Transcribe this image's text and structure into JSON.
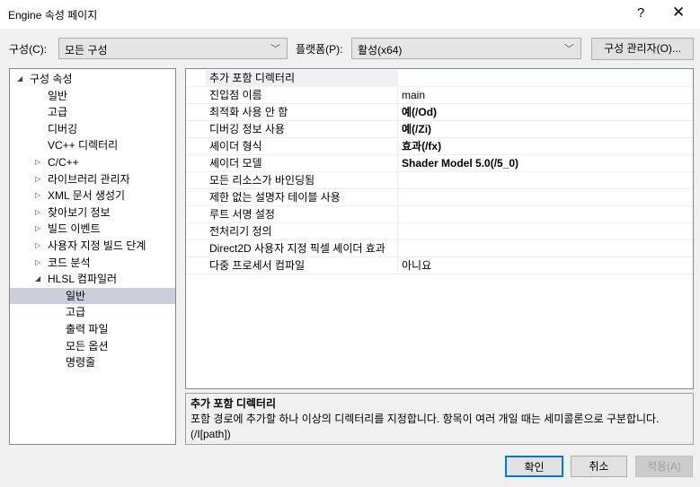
{
  "window": {
    "title": "Engine 속성 페이지",
    "help": "?",
    "close": "✕"
  },
  "toolbar": {
    "config_label": "구성(C):",
    "config_value": "모든 구성",
    "platform_label": "플랫폼(P):",
    "platform_value": "활성(x64)",
    "config_manager": "구성 관리자(O)..."
  },
  "tree": [
    {
      "label": "구성 속성",
      "level": 0,
      "arrow": "◢"
    },
    {
      "label": "일반",
      "level": 1,
      "arrow": ""
    },
    {
      "label": "고급",
      "level": 1,
      "arrow": ""
    },
    {
      "label": "디버깅",
      "level": 1,
      "arrow": ""
    },
    {
      "label": "VC++ 디렉터리",
      "level": 1,
      "arrow": ""
    },
    {
      "label": "C/C++",
      "level": 1,
      "arrow": "▷"
    },
    {
      "label": "라이브러리 관리자",
      "level": 1,
      "arrow": "▷"
    },
    {
      "label": "XML 문서 생성기",
      "level": 1,
      "arrow": "▷"
    },
    {
      "label": "찾아보기 정보",
      "level": 1,
      "arrow": "▷"
    },
    {
      "label": "빌드 이벤트",
      "level": 1,
      "arrow": "▷"
    },
    {
      "label": "사용자 지정 빌드 단계",
      "level": 1,
      "arrow": "▷"
    },
    {
      "label": "코드 분석",
      "level": 1,
      "arrow": "▷"
    },
    {
      "label": "HLSL 컴파일러",
      "level": 1,
      "arrow": "◢"
    },
    {
      "label": "일반",
      "level": 2,
      "arrow": "",
      "selected": true
    },
    {
      "label": "고급",
      "level": 2,
      "arrow": ""
    },
    {
      "label": "출력 파일",
      "level": 2,
      "arrow": ""
    },
    {
      "label": "모든 옵션",
      "level": 2,
      "arrow": ""
    },
    {
      "label": "명령줄",
      "level": 2,
      "arrow": ""
    }
  ],
  "properties": [
    {
      "name": "추가 포함 디렉터리",
      "value": "",
      "selected": true
    },
    {
      "name": "진입점 이름",
      "value": "main"
    },
    {
      "name": "최적화 사용 안 함",
      "value": "예(/Od)",
      "bold": true
    },
    {
      "name": "디버깅 정보 사용",
      "value": "예(/Zi)",
      "bold": true
    },
    {
      "name": "셰이더 형식",
      "value": "효과(/fx)",
      "bold": true
    },
    {
      "name": "셰이더 모델",
      "value": "Shader Model 5.0(/5_0)",
      "bold": true
    },
    {
      "name": "모든 리소스가 바인딩됨",
      "value": ""
    },
    {
      "name": "제한 없는 설명자 테이블 사용",
      "value": ""
    },
    {
      "name": "루트 서명 설정",
      "value": ""
    },
    {
      "name": "전처리기 정의",
      "value": ""
    },
    {
      "name": "Direct2D 사용자 지정 픽셀 셰이더 효과",
      "value": ""
    },
    {
      "name": "다중 프로세서 컴파일",
      "value": "아니요"
    }
  ],
  "description": {
    "title": "추가 포함 디렉터리",
    "text": "포함 경로에 추가할 하나 이상의 디렉터리를 지정합니다. 항목이 여러 개일 때는 세미콜론으로 구분합니다. (/I[path])"
  },
  "buttons": {
    "ok": "확인",
    "cancel": "취소",
    "apply": "적용(A)"
  }
}
